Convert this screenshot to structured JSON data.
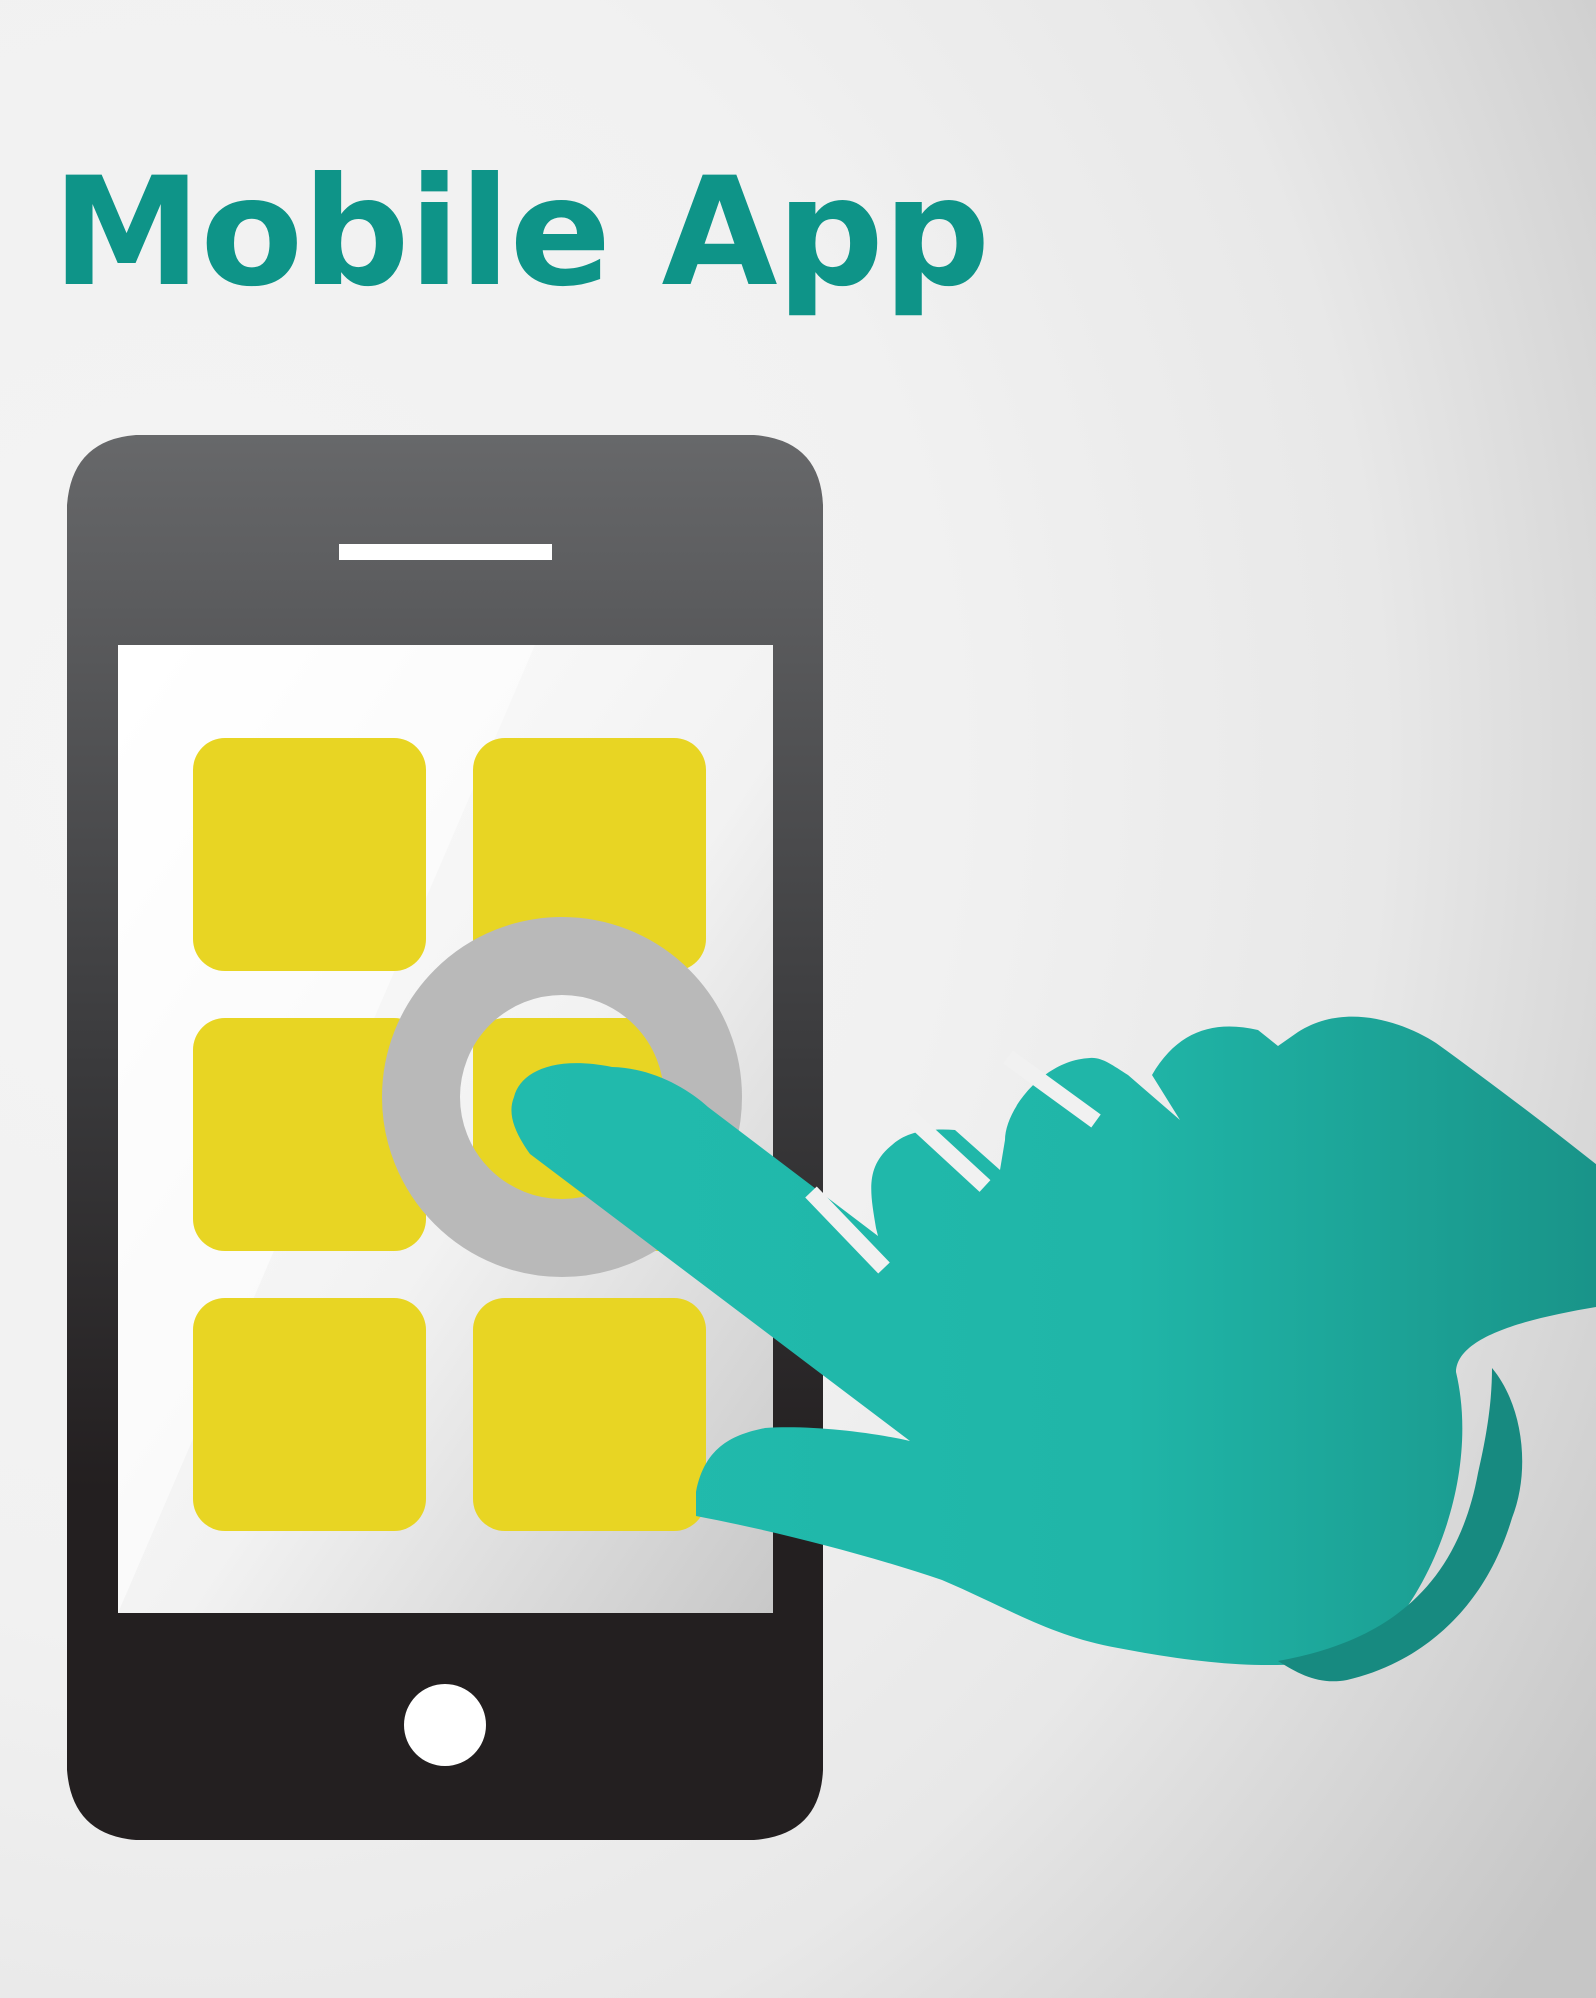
{
  "title": "Mobile App",
  "colors": {
    "title": "#0e9488",
    "phone_body_top": "#67686a",
    "phone_body_bottom": "#231f20",
    "app_tile": "#e8d523",
    "touch_ring": "#b9b9b9",
    "hand_light": "#21bbad",
    "hand_dark": "#178a80"
  },
  "phone": {
    "app_tiles": [
      {
        "row": 1,
        "col": 1
      },
      {
        "row": 1,
        "col": 2
      },
      {
        "row": 2,
        "col": 1
      },
      {
        "row": 2,
        "col": 2
      },
      {
        "row": 3,
        "col": 1
      },
      {
        "row": 3,
        "col": 2
      }
    ]
  },
  "icons": [
    "smartphone-icon",
    "pointing-hand-icon",
    "touch-ring-icon"
  ]
}
